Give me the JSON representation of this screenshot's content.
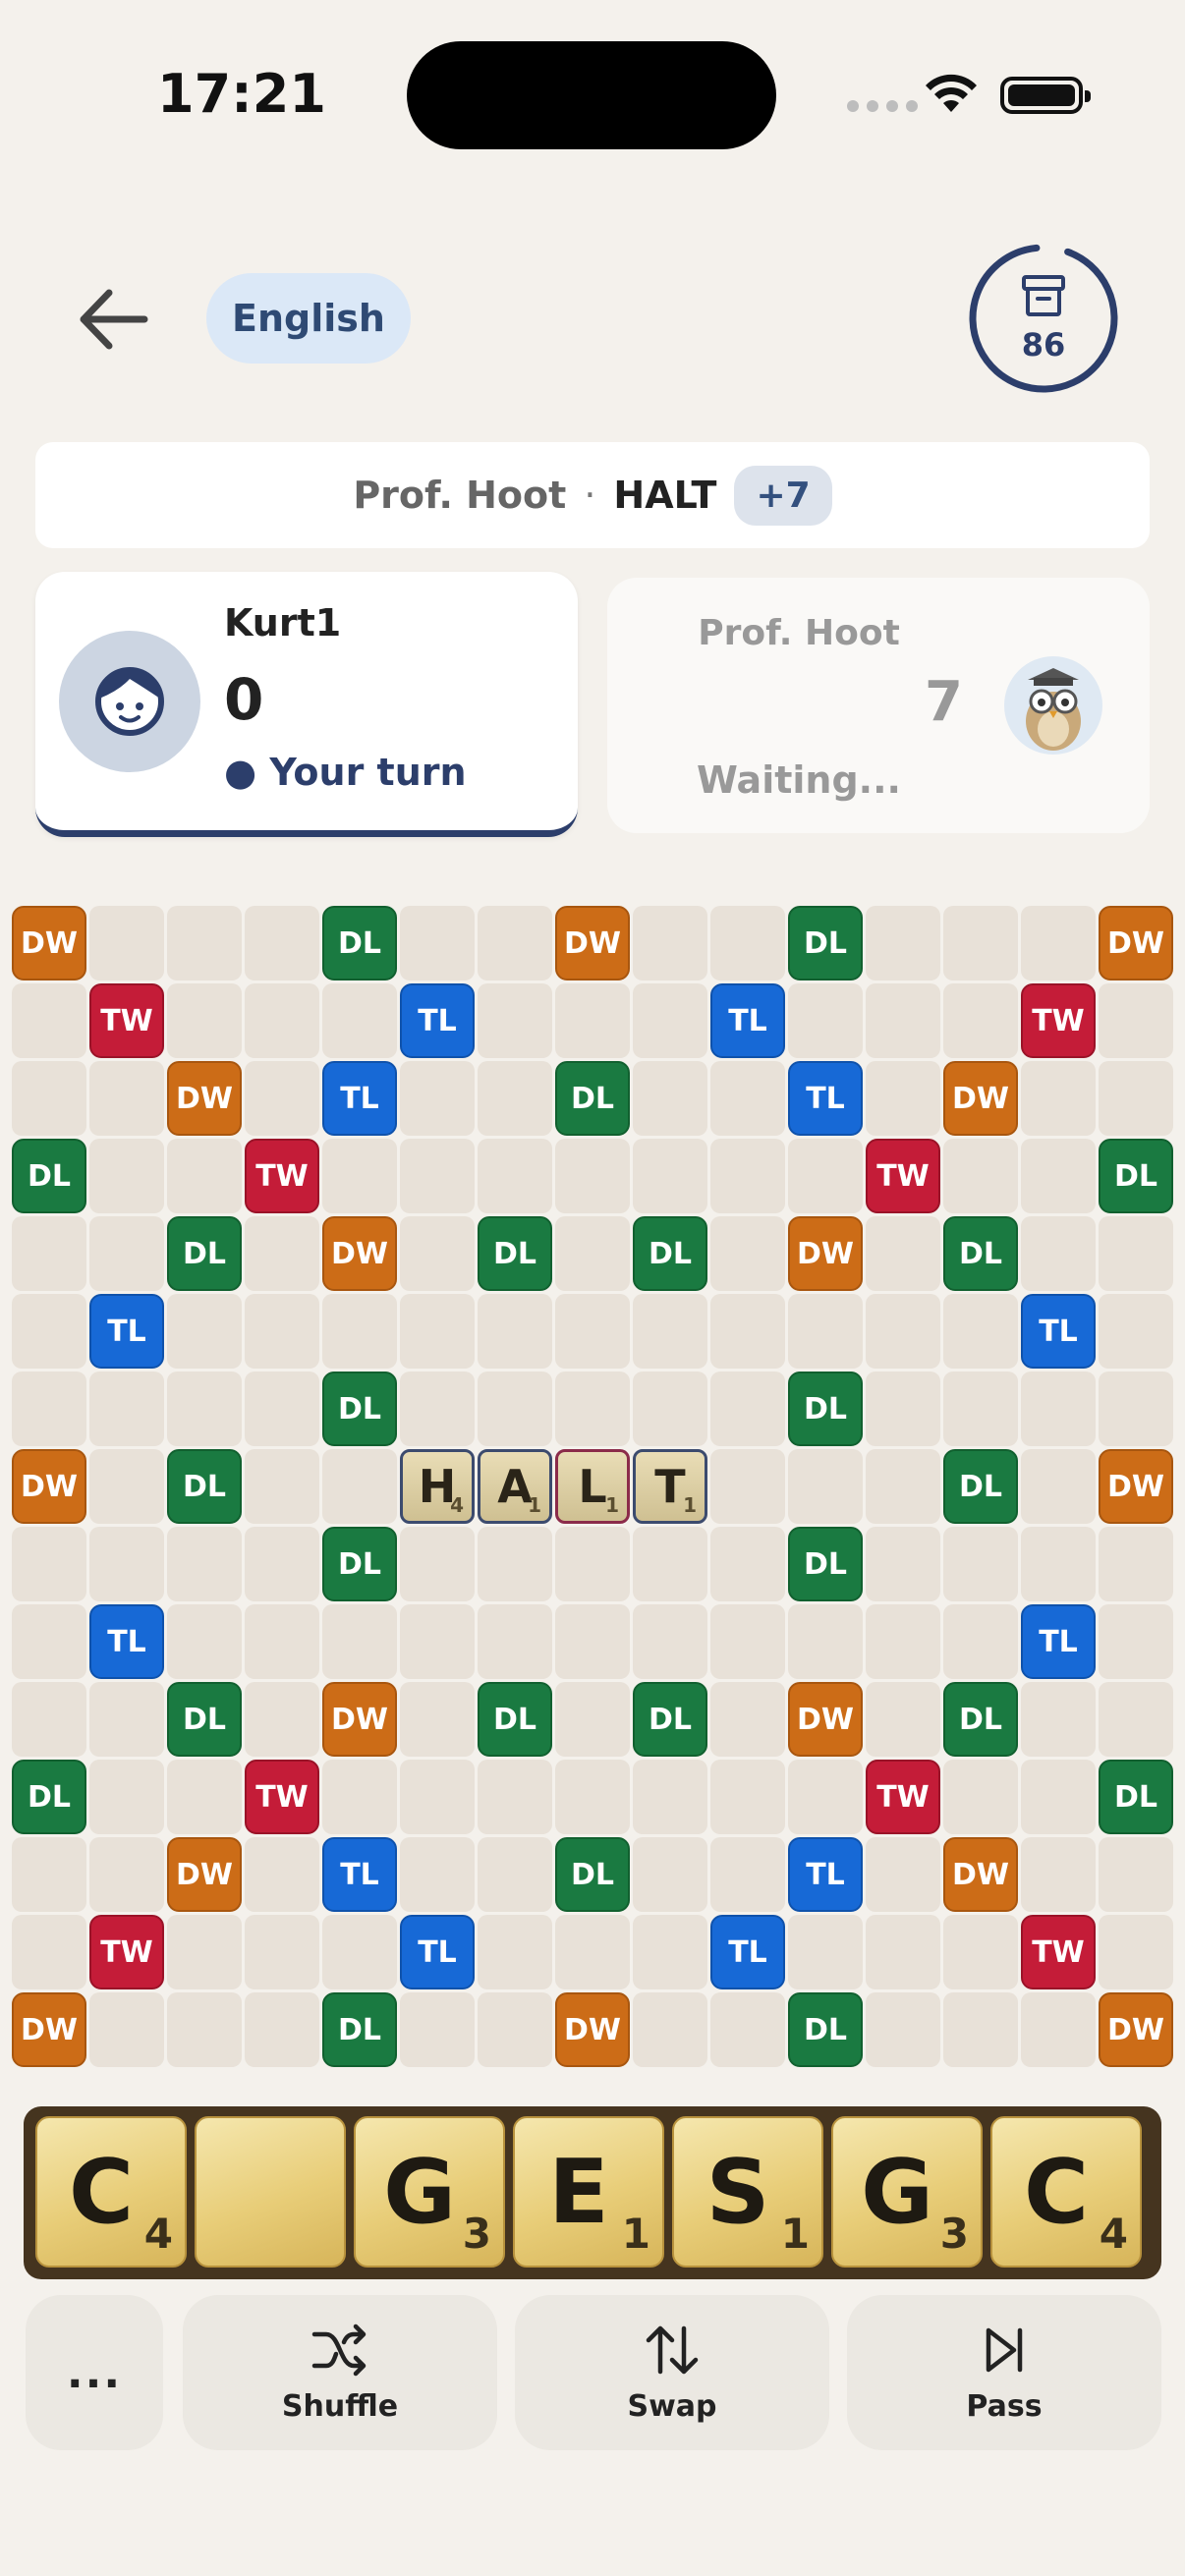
{
  "status_bar": {
    "time": "17:21"
  },
  "header": {
    "language": "English",
    "bag_count": "86"
  },
  "last_move": {
    "player": "Prof. Hoot",
    "separator": "·",
    "word": "HALT",
    "points": "+7"
  },
  "players": {
    "me": {
      "name": "Kurt1",
      "score": "0",
      "status": "● Your turn"
    },
    "opponent": {
      "name": "Prof. Hoot",
      "score": "7",
      "status": "Waiting..."
    }
  },
  "board": {
    "premium_legend": {
      "DW": "DW",
      "TW": "TW",
      "DL": "DL",
      "TL": "TL"
    },
    "layout": [
      "DW,,,,DL,,,DW,,,DL,,,,DW",
      ",TW,,,,TL,,,,TL,,,,TW,",
      ",,DW,,TL,,,DL,,,TL,,DW,,",
      "DL,,,TW,,,,,,,,TW,,,DL",
      ",,DL,,DW,,DL,,DL,,DW,,DL,,",
      ",TL,,,,,,,,,,,,TL,",
      ",,,,DL,,,,,,DL,,,,",
      "DW,,DL,,,,,,,,,,DL,,DW",
      ",,,,DL,,,,,,DL,,,,",
      ",TL,,,,,,,,,,,,TL,",
      ",,DL,,DW,,DL,,DL,,DW,,DL,,",
      "DL,,,TW,,,,,,,,TW,,,DL",
      ",,DW,,TL,,,DL,,,TL,,DW,,",
      ",TW,,,,TL,,,,TL,,,,TW,",
      "DW,,,,DL,,,DW,,,DL,,,,DW"
    ],
    "placed_tiles": [
      {
        "row": 7,
        "col": 5,
        "letter": "H",
        "value": "4"
      },
      {
        "row": 7,
        "col": 6,
        "letter": "A",
        "value": "1"
      },
      {
        "row": 7,
        "col": 7,
        "letter": "L",
        "value": "1",
        "highlight": true
      },
      {
        "row": 7,
        "col": 8,
        "letter": "T",
        "value": "1"
      }
    ]
  },
  "rack": [
    {
      "letter": "C",
      "value": "4"
    },
    {
      "letter": "",
      "value": ""
    },
    {
      "letter": "G",
      "value": "3"
    },
    {
      "letter": "E",
      "value": "1"
    },
    {
      "letter": "S",
      "value": "1"
    },
    {
      "letter": "G",
      "value": "3"
    },
    {
      "letter": "C",
      "value": "4"
    }
  ],
  "actions": {
    "more": "...",
    "shuffle": "Shuffle",
    "swap": "Swap",
    "pass": "Pass"
  },
  "icons": {
    "back": "arrow-left-icon",
    "bag": "archive-box-icon",
    "shuffle": "shuffle-icon",
    "swap": "swap-arrows-icon",
    "pass": "skip-forward-icon"
  }
}
